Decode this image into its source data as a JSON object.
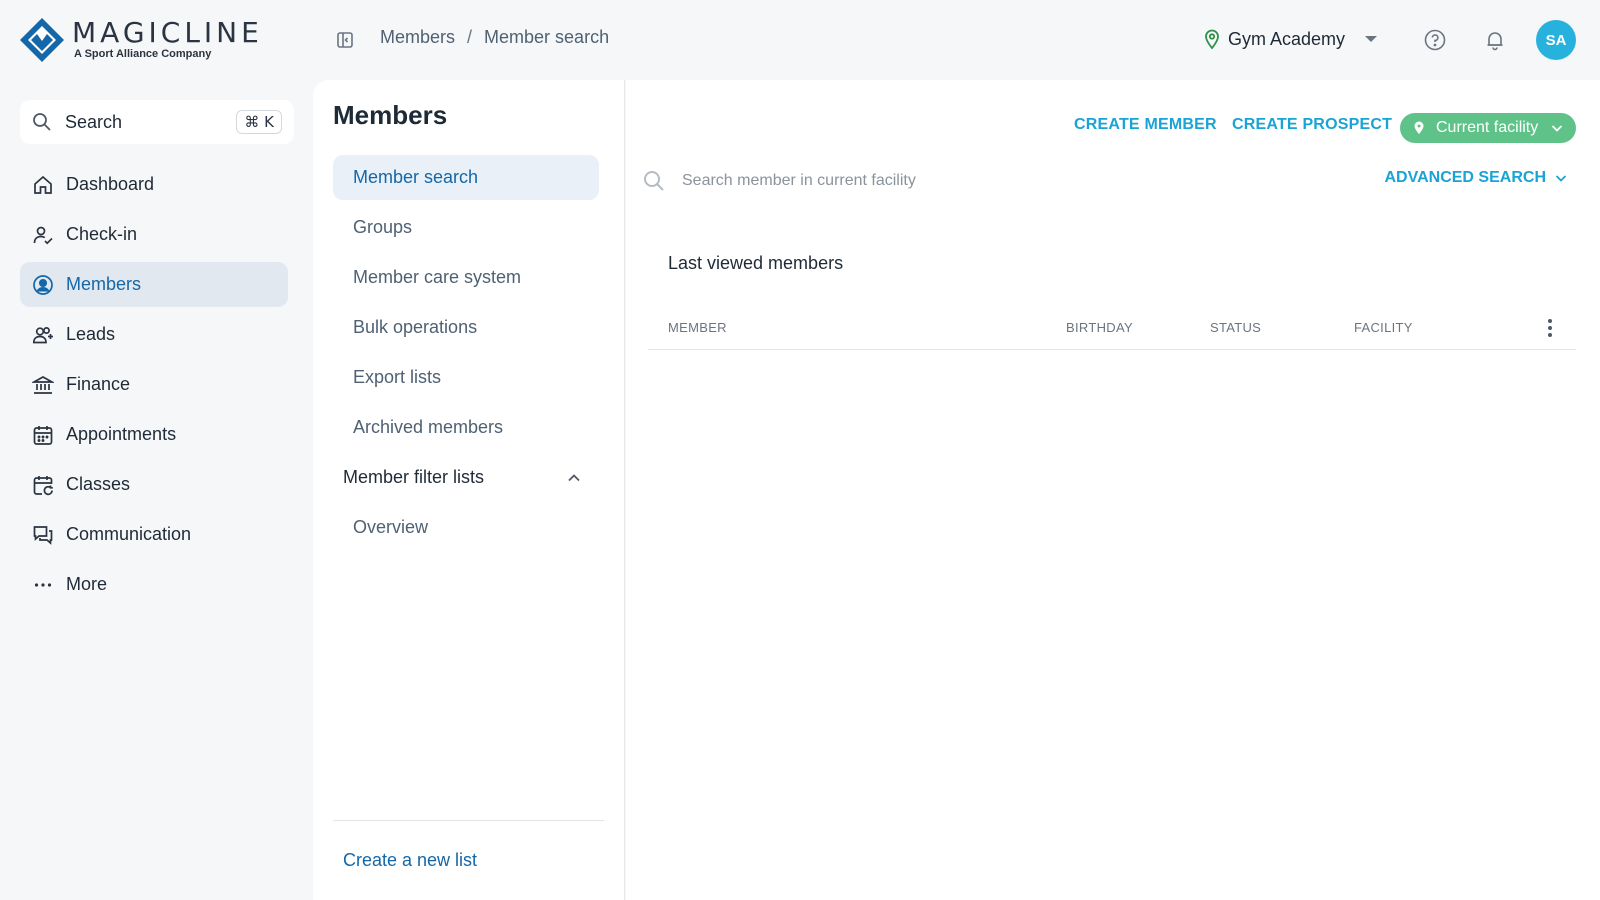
{
  "app": {
    "logo_word": "MAGICLINE",
    "logo_sub": "A Sport Alliance Company",
    "brand_color": "#1467a8",
    "accent_color": "#1aa3d6"
  },
  "header": {
    "breadcrumb": [
      "Members",
      "Member search"
    ],
    "facility": "Gym Academy",
    "help_icon": "help-circle-icon",
    "notifications_icon": "bell-icon",
    "avatar_initials": "SA"
  },
  "sidebar": {
    "search_label": "Search",
    "search_shortcut": "⌘ K",
    "items": [
      {
        "label": "Dashboard",
        "icon": "home-icon"
      },
      {
        "label": "Check-in",
        "icon": "user-check-icon"
      },
      {
        "label": "Members",
        "icon": "user-circle-icon",
        "active": true
      },
      {
        "label": "Leads",
        "icon": "users-plus-icon"
      },
      {
        "label": "Finance",
        "icon": "bank-icon"
      },
      {
        "label": "Appointments",
        "icon": "calendar-icon"
      },
      {
        "label": "Classes",
        "icon": "calendar-repeat-icon"
      },
      {
        "label": "Communication",
        "icon": "chat-icon"
      },
      {
        "label": "More",
        "icon": "more-dots-icon"
      }
    ]
  },
  "subpanel": {
    "title": "Members",
    "items": [
      {
        "label": "Member search",
        "active": true
      },
      {
        "label": "Groups"
      },
      {
        "label": "Member care system"
      },
      {
        "label": "Bulk operations"
      },
      {
        "label": "Export lists"
      },
      {
        "label": "Archived members"
      }
    ],
    "group_label": "Member filter lists",
    "group_items": [
      {
        "label": "Overview"
      }
    ],
    "create_list": "Create a new list"
  },
  "main": {
    "create_member": "CREATE MEMBER",
    "create_prospect": "CREATE PROSPECT",
    "facility_chip": "Current facility",
    "facility_chip_color": "#5fc389",
    "search_placeholder": "Search member in current facility",
    "advanced_search": "ADVANCED SEARCH",
    "section_title": "Last viewed members",
    "columns": [
      "MEMBER",
      "BIRTHDAY",
      "STATUS",
      "FACILITY"
    ],
    "rows": []
  }
}
